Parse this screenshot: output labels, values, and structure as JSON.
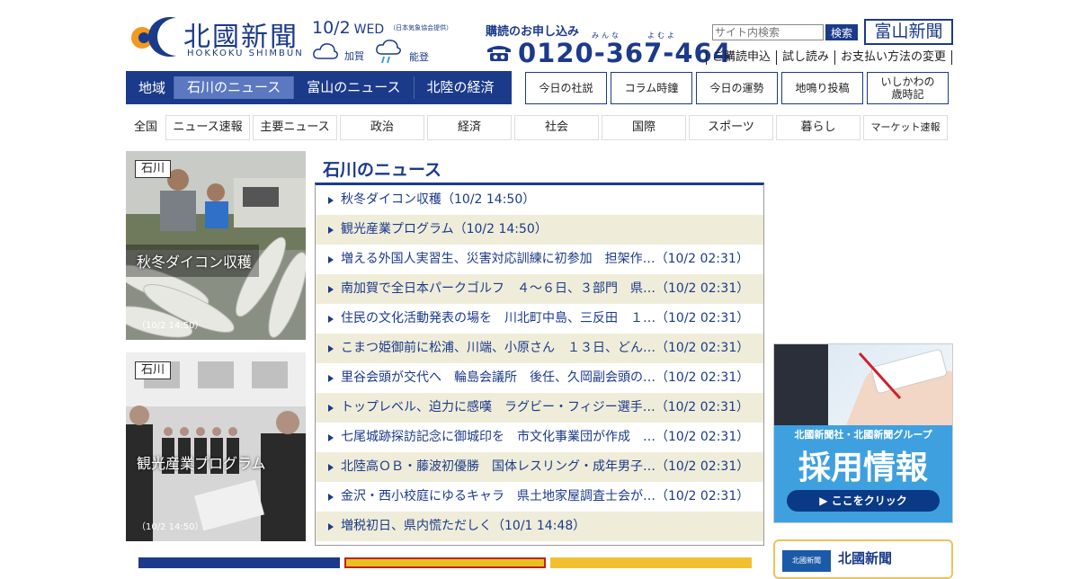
{
  "header": {
    "logo_title": "北國新聞",
    "logo_sub": "HOKKOKU SHIMBUN",
    "date": "10/2",
    "weekday": "WED",
    "weather_source": "（日本気象協会提供）",
    "weather": [
      {
        "area": "加賀",
        "icon": "cloud-icon"
      },
      {
        "area": "能登",
        "icon": "cloud-rain-icon"
      }
    ],
    "subscribe_label": "購読のお申し込み",
    "subscribe_ruby1": "みんな",
    "subscribe_ruby2": "よむよ",
    "phone": "0120-367-464",
    "search_placeholder": "サイト内検索",
    "search_button": "検索",
    "toyama_logo": "富山新聞",
    "links": [
      "ご購読申込",
      "試し読み",
      "お支払い方法の変更"
    ]
  },
  "region_nav": {
    "label": "地域",
    "tabs": [
      "石川のニュース",
      "富山のニュース",
      "北陸の経済"
    ],
    "active_index": 0
  },
  "boxes": [
    "今日の社説",
    "コラム時鐘",
    "今日の運勢",
    "地鳴り投稿",
    "いしかわの\n歳時記"
  ],
  "categories": {
    "all": "全国",
    "items": [
      "ニュース速報",
      "主要ニュース",
      "政治",
      "経済",
      "社会",
      "国際",
      "スポーツ",
      "暮らし",
      "マーケット速報"
    ]
  },
  "photos": [
    {
      "badge": "石川",
      "caption": "秋冬ダイコン収穫",
      "time": "（10/2 14:50）"
    },
    {
      "badge": "石川",
      "caption": "観光産業プログラム",
      "time": "（10/2 14:50）"
    }
  ],
  "news": {
    "title": "石川のニュース",
    "items": [
      "秋冬ダイコン収穫（10/2 14:50）",
      "観光産業プログラム（10/2 14:50）",
      "増える外国人実習生、災害対応訓練に初参加　担架作…（10/2 02:31）",
      "南加賀で全日本パークゴルフ　４～６日、３部門　県…（10/2 02:31）",
      "住民の文化活動発表の場を　川北町中島、三反田　１…（10/2 02:31）",
      "こまつ姫御前に松浦、川端、小原さん　１３日、どん…（10/2 02:31）",
      "里谷会頭が交代へ　輪島会議所　後任、久岡副会頭の…（10/2 02:31）",
      "トップレベル、迫力に感嘆　ラグビー・フィジー選手…（10/2 02:31）",
      "七尾城跡探訪記念に御城印を　市文化事業団が作成　…（10/2 02:31）",
      "北陸高ＯＢ・藤波初優勝　国体レスリング・成年男子…（10/2 02:31）",
      "金沢・西小校庭にゆるキャラ　県土地家屋調査士会が…（10/2 02:31）",
      "増税初日、県内慌ただしく（10/1 14:48）"
    ]
  },
  "ad": {
    "line1": "北國新聞社・北國新聞グループ",
    "line2": "採用情報",
    "cta": "▶ ここをクリック"
  },
  "ad2": {
    "logo_text": "北國新聞",
    "name": "北國新聞"
  },
  "colors": {
    "brand": "#1b3a8a",
    "row_alt": "#efedd9",
    "active_tab": "#5b78c0"
  }
}
